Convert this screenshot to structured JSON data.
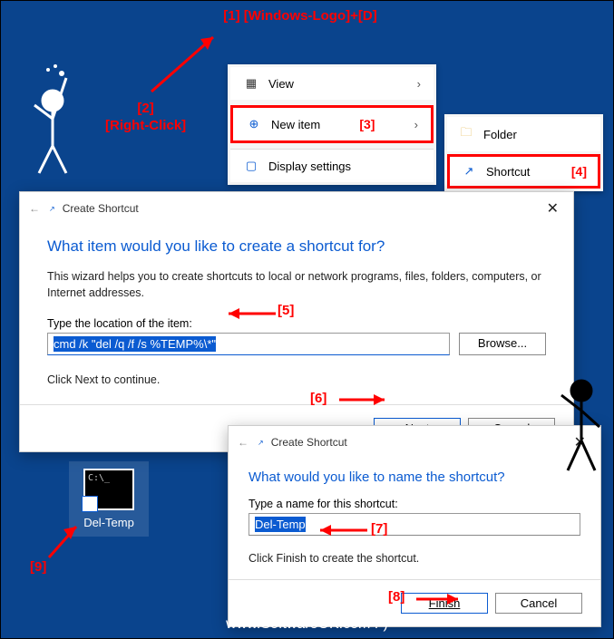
{
  "tags": {
    "t1": "[1]  [Windows-Logo]+[D]",
    "t2": "[2]\n[Right-Click]",
    "t3": "[3]",
    "t4": "[4]",
    "t5": "[5]",
    "t6": "[6]",
    "t7": "[7]",
    "t8": "[8]",
    "t9": "[9]"
  },
  "ctx": {
    "view": "View",
    "newitem": "New item",
    "display": "Display settings"
  },
  "sub": {
    "folder": "Folder",
    "shortcut": "Shortcut"
  },
  "wiz1": {
    "title": "Create Shortcut",
    "h1": "What item would you like to create a shortcut for?",
    "p": "This wizard helps you to create shortcuts to local or network programs, files, folders, computers, or Internet addresses.",
    "lab": "Type the location of the item:",
    "val": "cmd /k \"del /q /f /s %TEMP%\\*\"",
    "browse": "Browse...",
    "hint": "Click Next to continue.",
    "next": "Next",
    "cancel": "Cancel"
  },
  "wiz2": {
    "title": "Create Shortcut",
    "h1": "What would you like to name the shortcut?",
    "lab": "Type a name for this shortcut:",
    "val": "Del-Temp",
    "hint": "Click Finish to create the shortcut.",
    "finish": "Finish",
    "cancel": "Cancel"
  },
  "deskicon": "Del-Temp",
  "credit": "www.SoftwareOK.com :-)",
  "watermark": "SoftwareOK.com"
}
